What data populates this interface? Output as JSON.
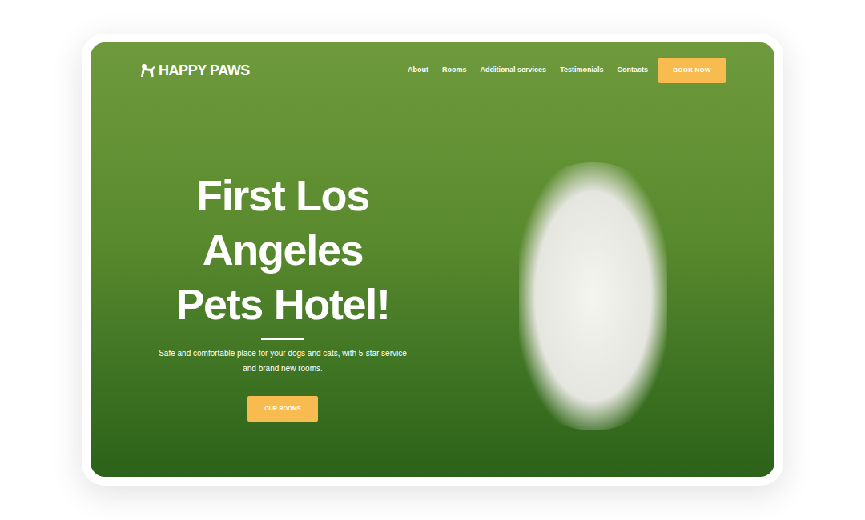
{
  "logo": {
    "text": "HAPPY PAWS"
  },
  "nav": {
    "links": [
      "About",
      "Rooms",
      "Additional services",
      "Testimonials",
      "Contacts"
    ],
    "button": "BOOK NOW"
  },
  "hero": {
    "title_lines": [
      "First Los",
      "Angeles",
      "Pets Hotel!"
    ],
    "subtitle_lines": [
      "Safe and comfortable place for your dogs and cats, with 5-star service",
      "and brand new rooms."
    ],
    "button": "OUR ROOMS"
  }
}
